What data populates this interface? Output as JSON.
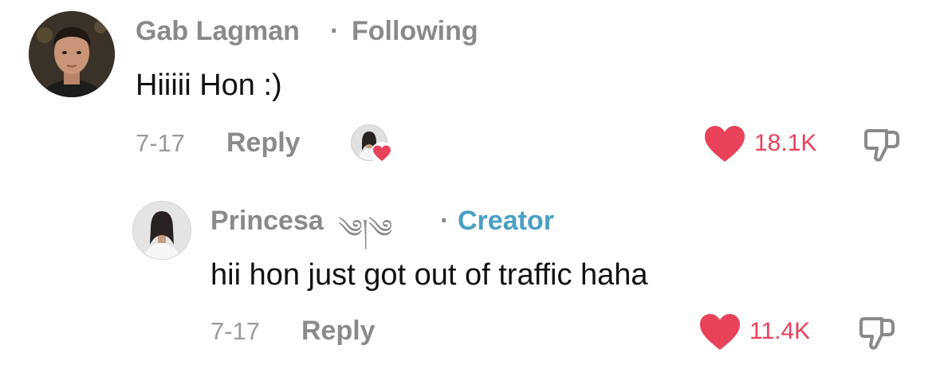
{
  "comments": [
    {
      "username": "Gab Lagman",
      "separator": "·",
      "relation": "Following",
      "text": "Hiiiii Hon :)",
      "date": "7-17",
      "reply_label": "Reply",
      "like_count": "18.1K",
      "liked_by_creator": true,
      "icons": [
        "avatar",
        "creator-like-avatar",
        "heart-icon",
        "dislike-icon"
      ]
    },
    {
      "username": "Princesa",
      "username_decoration": "༄།༄",
      "separator": "·",
      "relation": "Creator",
      "text": "hii hon just got out of traffic haha",
      "date": "7-17",
      "reply_label": "Reply",
      "like_count": "11.4K",
      "icons": [
        "avatar",
        "heart-icon",
        "dislike-icon"
      ]
    }
  ],
  "colors": {
    "like_red": "#e8435a",
    "creator_blue": "#4a9fc3",
    "meta_gray": "#8a8a8a"
  }
}
